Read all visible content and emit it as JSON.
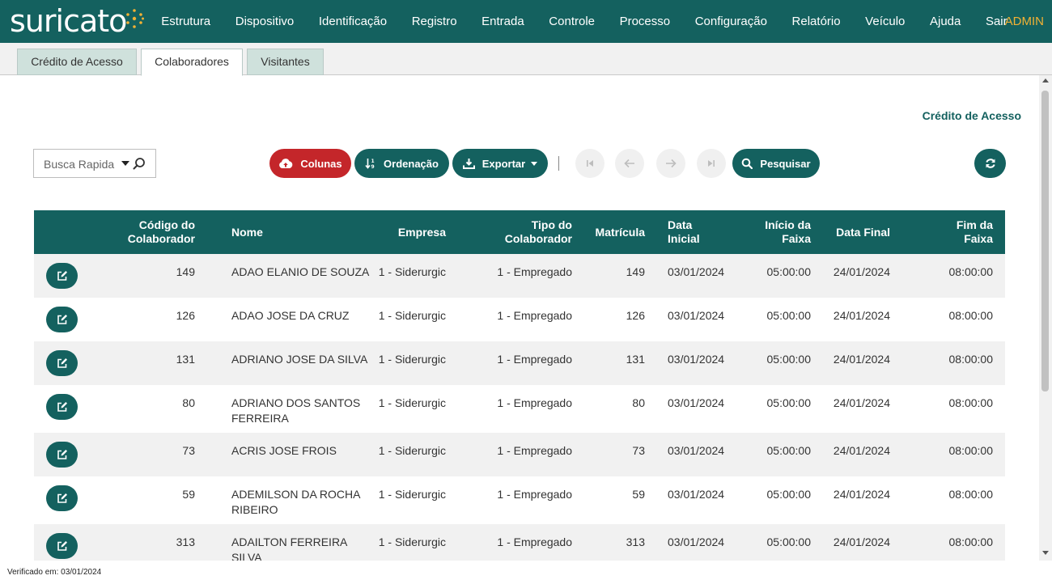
{
  "brand": {
    "name": "suricato"
  },
  "nav": {
    "items": [
      "Estrutura",
      "Dispositivo",
      "Identificação",
      "Registro",
      "Entrada",
      "Controle",
      "Processo",
      "Configuração",
      "Relatório",
      "Veículo",
      "Ajuda",
      "Sair"
    ],
    "user": "ADMIN"
  },
  "tabs": {
    "credito": "Crédito de Acesso",
    "colaboradores": "Colaboradores",
    "visitantes": "Visitantes"
  },
  "section_title": "Crédito de Acesso",
  "toolbar": {
    "search_placeholder": "Busca Rapida",
    "colunas": "Colunas",
    "ordenacao": "Ordenação",
    "exportar": "Exportar",
    "pesquisar": "Pesquisar"
  },
  "table": {
    "headers": {
      "codigo": [
        "Código do",
        "Colaborador"
      ],
      "nome": "Nome",
      "empresa": "Empresa",
      "tipo": [
        "Tipo do",
        "Colaborador"
      ],
      "matricula": "Matrícula",
      "data_inicial": [
        "Data",
        "Inicial"
      ],
      "inicio_faixa": [
        "Início da",
        "Faixa"
      ],
      "data_final": "Data Final",
      "fim_faixa": [
        "Fim da",
        "Faixa"
      ]
    },
    "rows": [
      {
        "codigo": "149",
        "nome": [
          "ADAO ELANIO DE SOUZA"
        ],
        "empresa": "1 - Siderurgic",
        "tipo": "1 - Empregado",
        "matricula": "149",
        "data_inicial": "03/01/2024",
        "inicio_faixa": "05:00:00",
        "data_final": "24/01/2024",
        "fim_faixa": "08:00:00"
      },
      {
        "codigo": "126",
        "nome": [
          "ADAO JOSE DA CRUZ"
        ],
        "empresa": "1 - Siderurgic",
        "tipo": "1 - Empregado",
        "matricula": "126",
        "data_inicial": "03/01/2024",
        "inicio_faixa": "05:00:00",
        "data_final": "24/01/2024",
        "fim_faixa": "08:00:00"
      },
      {
        "codigo": "131",
        "nome": [
          "ADRIANO JOSE DA SILVA"
        ],
        "empresa": "1 - Siderurgic",
        "tipo": "1 - Empregado",
        "matricula": "131",
        "data_inicial": "03/01/2024",
        "inicio_faixa": "05:00:00",
        "data_final": "24/01/2024",
        "fim_faixa": "08:00:00"
      },
      {
        "codigo": "80",
        "nome": [
          "ADRIANO DOS SANTOS",
          "FERREIRA"
        ],
        "empresa": "1 - Siderurgic",
        "tipo": "1 - Empregado",
        "matricula": "80",
        "data_inicial": "03/01/2024",
        "inicio_faixa": "05:00:00",
        "data_final": "24/01/2024",
        "fim_faixa": "08:00:00"
      },
      {
        "codigo": "73",
        "nome": [
          "ACRIS JOSE FROIS"
        ],
        "empresa": "1 - Siderurgic",
        "tipo": "1 - Empregado",
        "matricula": "73",
        "data_inicial": "03/01/2024",
        "inicio_faixa": "05:00:00",
        "data_final": "24/01/2024",
        "fim_faixa": "08:00:00"
      },
      {
        "codigo": "59",
        "nome": [
          "ADEMILSON DA ROCHA",
          "RIBEIRO"
        ],
        "empresa": "1 - Siderurgic",
        "tipo": "1 - Empregado",
        "matricula": "59",
        "data_inicial": "03/01/2024",
        "inicio_faixa": "05:00:00",
        "data_final": "24/01/2024",
        "fim_faixa": "08:00:00"
      },
      {
        "codigo": "313",
        "nome": [
          "ADAILTON FERREIRA",
          "SILVA"
        ],
        "empresa": "1 - Siderurgic",
        "tipo": "1 - Empregado",
        "matricula": "313",
        "data_inicial": "03/01/2024",
        "inicio_faixa": "05:00:00",
        "data_final": "24/01/2024",
        "fim_faixa": "08:00:00"
      }
    ]
  },
  "footer": {
    "verified": "Verificado em: 03/01/2024"
  },
  "colors": {
    "primary": "#14615f",
    "danger": "#c4262a",
    "admin": "#f2b134"
  }
}
